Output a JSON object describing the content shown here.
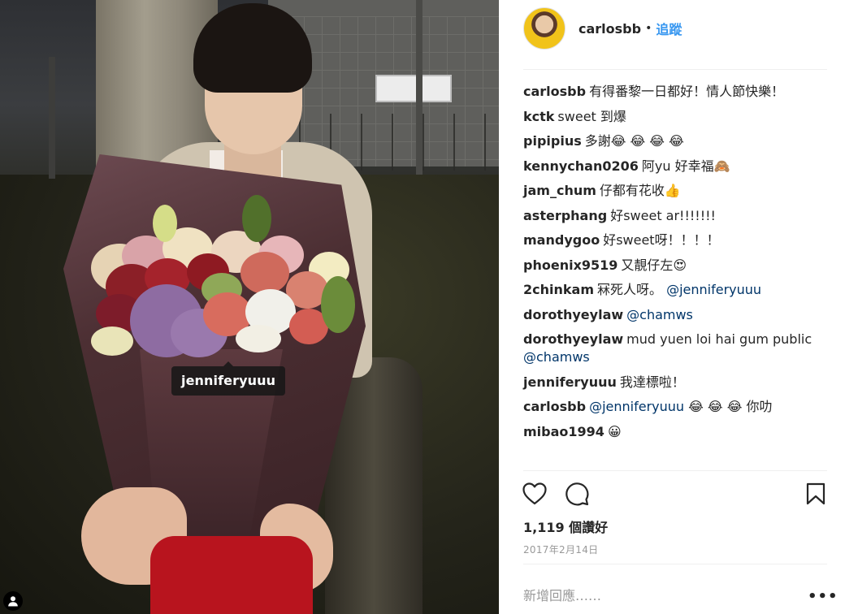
{
  "post": {
    "username": "carlosbb",
    "follow_label": "追蹤",
    "tagged_user": "jenniferyuuu",
    "likes": "1,119 個讚好",
    "date": "2017年2月14日",
    "add_comment_placeholder": "新增回應……",
    "more_label": "•••"
  },
  "icons": {
    "like": "heart-icon",
    "comment": "comment-icon",
    "save": "bookmark-icon",
    "user_tag": "user-tag-icon"
  },
  "comments": [
    {
      "author": "carlosbb",
      "text": "有得番黎一日都好！情人節快樂！",
      "mention": "",
      "after": ""
    },
    {
      "author": "kctk",
      "text": "sweet 到爆",
      "mention": "",
      "after": ""
    },
    {
      "author": "pipipius",
      "text": "多謝😂 😂 😂 😂",
      "mention": "",
      "after": ""
    },
    {
      "author": "kennychan0206",
      "text": "阿yu 好幸福🙈",
      "mention": "",
      "after": ""
    },
    {
      "author": "jam_chum",
      "text": "仔都有花收👍",
      "mention": "",
      "after": ""
    },
    {
      "author": "asterphang",
      "text": "好sweet ar!!!!!!!",
      "mention": "",
      "after": ""
    },
    {
      "author": "mandygoo",
      "text": "好sweet呀！！！！",
      "mention": "",
      "after": ""
    },
    {
      "author": "phoenix9519",
      "text": "又靚仔左😍",
      "mention": "",
      "after": ""
    },
    {
      "author": "2chinkam",
      "text": "冧死人呀。",
      "mention": "@jenniferyuuu",
      "after": ""
    },
    {
      "author": "dorothyeylaw",
      "text": "",
      "mention": "@chamws",
      "after": ""
    },
    {
      "author": "dorothyeylaw",
      "text": "mud yuen loi hai gum public",
      "mention": "@chamws",
      "after": ""
    },
    {
      "author": "jenniferyuuu",
      "text": "我達標啦！",
      "mention": "",
      "after": ""
    },
    {
      "author": "carlosbb",
      "text": "",
      "mention": "@jenniferyuuu",
      "after": "😂 😂 😂 你叻"
    },
    {
      "author": "mibao1994",
      "text": "😀",
      "mention": "",
      "after": ""
    }
  ],
  "colors": {
    "link": "#3897f0",
    "mention": "#003569",
    "text": "#262626",
    "muted": "#999999"
  }
}
